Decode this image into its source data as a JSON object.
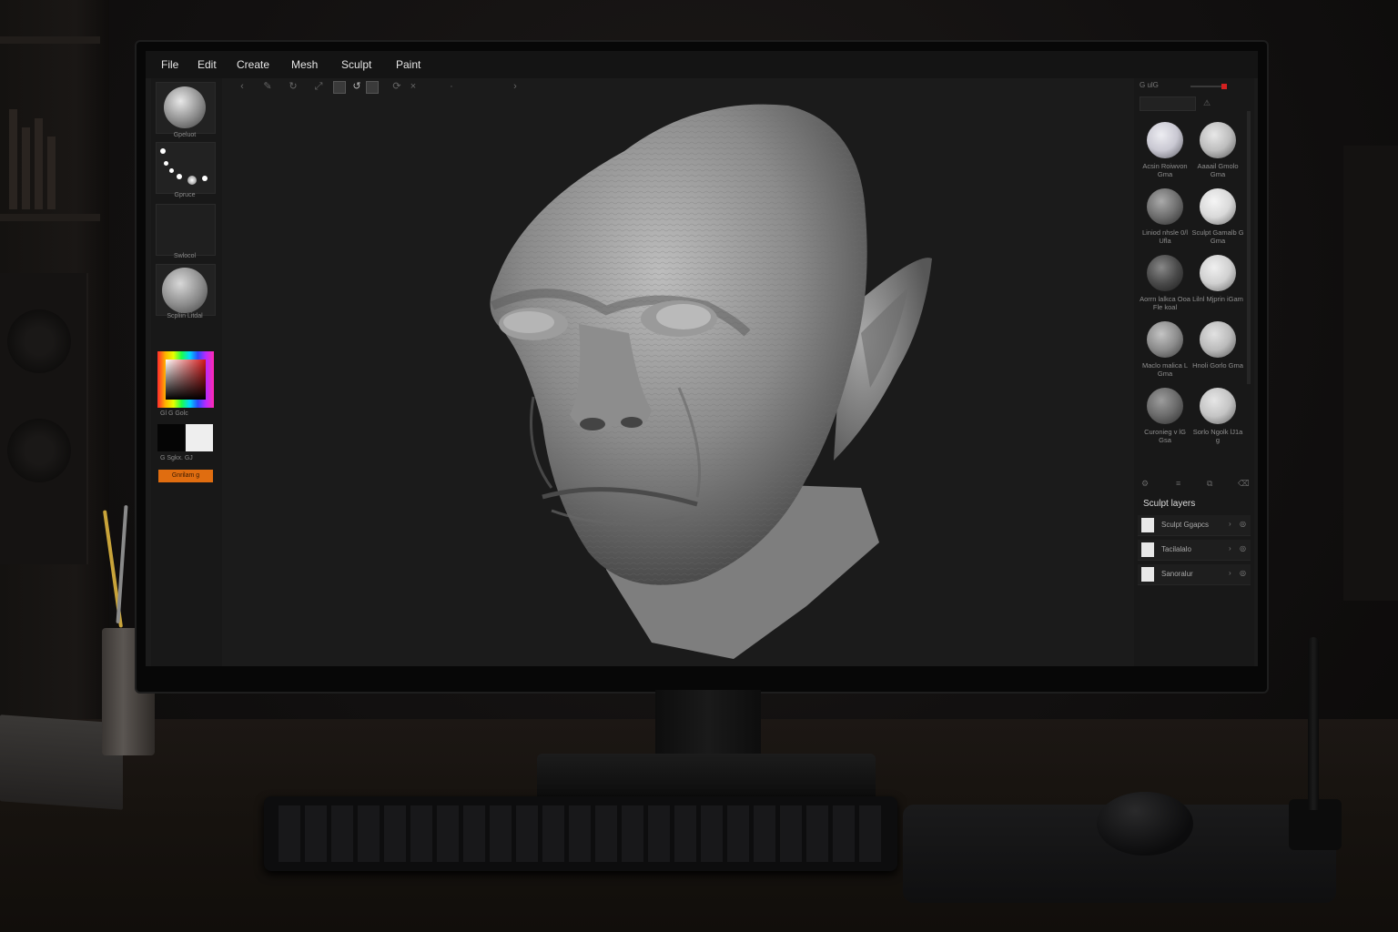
{
  "menu": [
    "File",
    "Edit",
    "Create",
    "Mesh",
    "Sculpt",
    "Paint"
  ],
  "left_panel": {
    "tile_labels": [
      "Gpeluot",
      "Gpruce",
      "Swlocol",
      "Scpliin Litdal"
    ],
    "color_label": "Gl  G  Golc",
    "swatch_label": "G  Sgkx.  GJ",
    "action_button": "Gnrilam  g"
  },
  "right_panel": {
    "tab_label": "G  ulG",
    "brushes": [
      {
        "name": "Acsin Roiwvon Gma",
        "color": "#c9c8d2"
      },
      {
        "name": "Aaaail Gmolo Gma",
        "color": "#bdbdbd"
      },
      {
        "name": "Liniod nhsle 0/l Ufla",
        "color": "#6f6f6f"
      },
      {
        "name": "Sculpt Gamalb G Gma",
        "color": "#d9d9d9"
      },
      {
        "name": "Aorrn lalkca Ooa Fle koal",
        "color": "#4a4a4a"
      },
      {
        "name": "Lilnl Mjprin iGam",
        "color": "#d0d0d0"
      },
      {
        "name": "Maclo malica L Gma",
        "color": "#8c8c8c"
      },
      {
        "name": "Hnoli Gorlo Gma",
        "color": "#bbbbbb"
      },
      {
        "name": "Curonieg v lG Gsa",
        "color": "#6a6a6a"
      },
      {
        "name": "Sorlo Ngolk lJ1a g",
        "color": "#c4c4c4"
      }
    ],
    "layers_title": "Sculpt layers",
    "layers": [
      "Sculpt Ggapcs",
      "Tacilalalo",
      "Sanoralur"
    ]
  },
  "colors": {
    "accent_orange": "#e06d10",
    "slider_red": "#d42020"
  }
}
